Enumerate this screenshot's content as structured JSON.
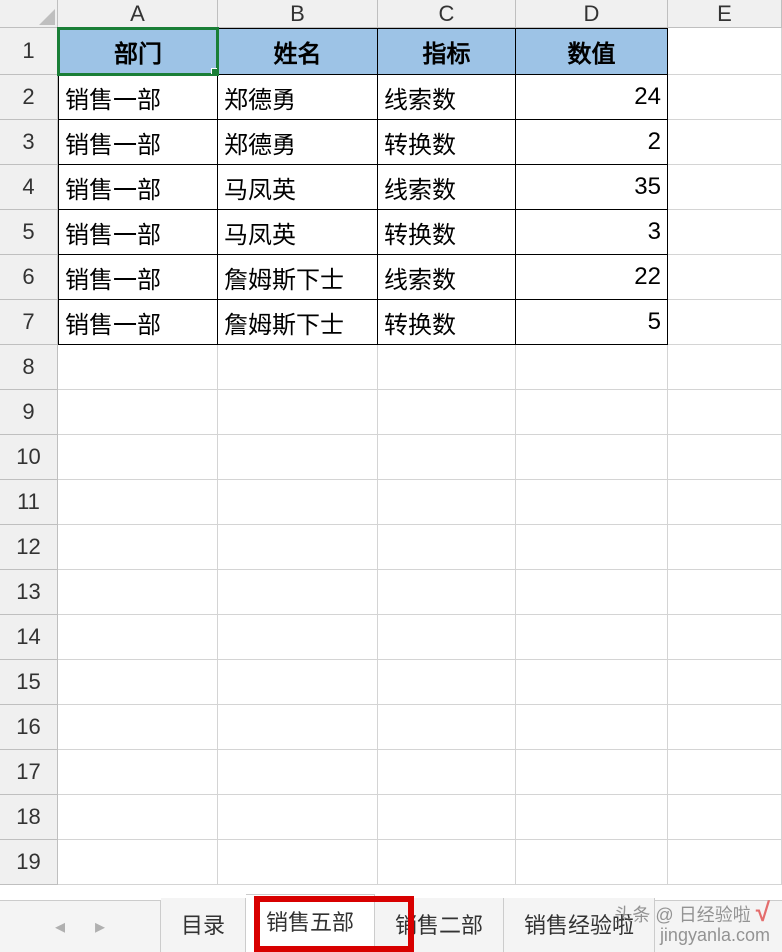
{
  "columns": [
    "A",
    "B",
    "C",
    "D",
    "E"
  ],
  "row_numbers": [
    1,
    2,
    3,
    4,
    5,
    6,
    7,
    8,
    9,
    10,
    11,
    12,
    13,
    14,
    15,
    16,
    17,
    18,
    19
  ],
  "selected_cell": "A1",
  "headers": {
    "A": "部门",
    "B": "姓名",
    "C": "指标",
    "D": "数值"
  },
  "rows": [
    {
      "A": "销售一部",
      "B": "郑德勇",
      "C": "线索数",
      "D": 24
    },
    {
      "A": "销售一部",
      "B": "郑德勇",
      "C": "转换数",
      "D": 2
    },
    {
      "A": "销售一部",
      "B": "马凤英",
      "C": "线索数",
      "D": 35
    },
    {
      "A": "销售一部",
      "B": "马凤英",
      "C": "转换数",
      "D": 3
    },
    {
      "A": "销售一部",
      "B": "詹姆斯下士",
      "C": "线索数",
      "D": 22
    },
    {
      "A": "销售一部",
      "B": "詹姆斯下士",
      "C": "转换数",
      "D": 5
    }
  ],
  "tabs": {
    "items": [
      "目录",
      "销售五部",
      "销售二部",
      "销售经验啦"
    ],
    "active_index": 1
  },
  "watermark": {
    "line1": "头条 @ 日经验啦",
    "line2": "jingyanla.com"
  }
}
